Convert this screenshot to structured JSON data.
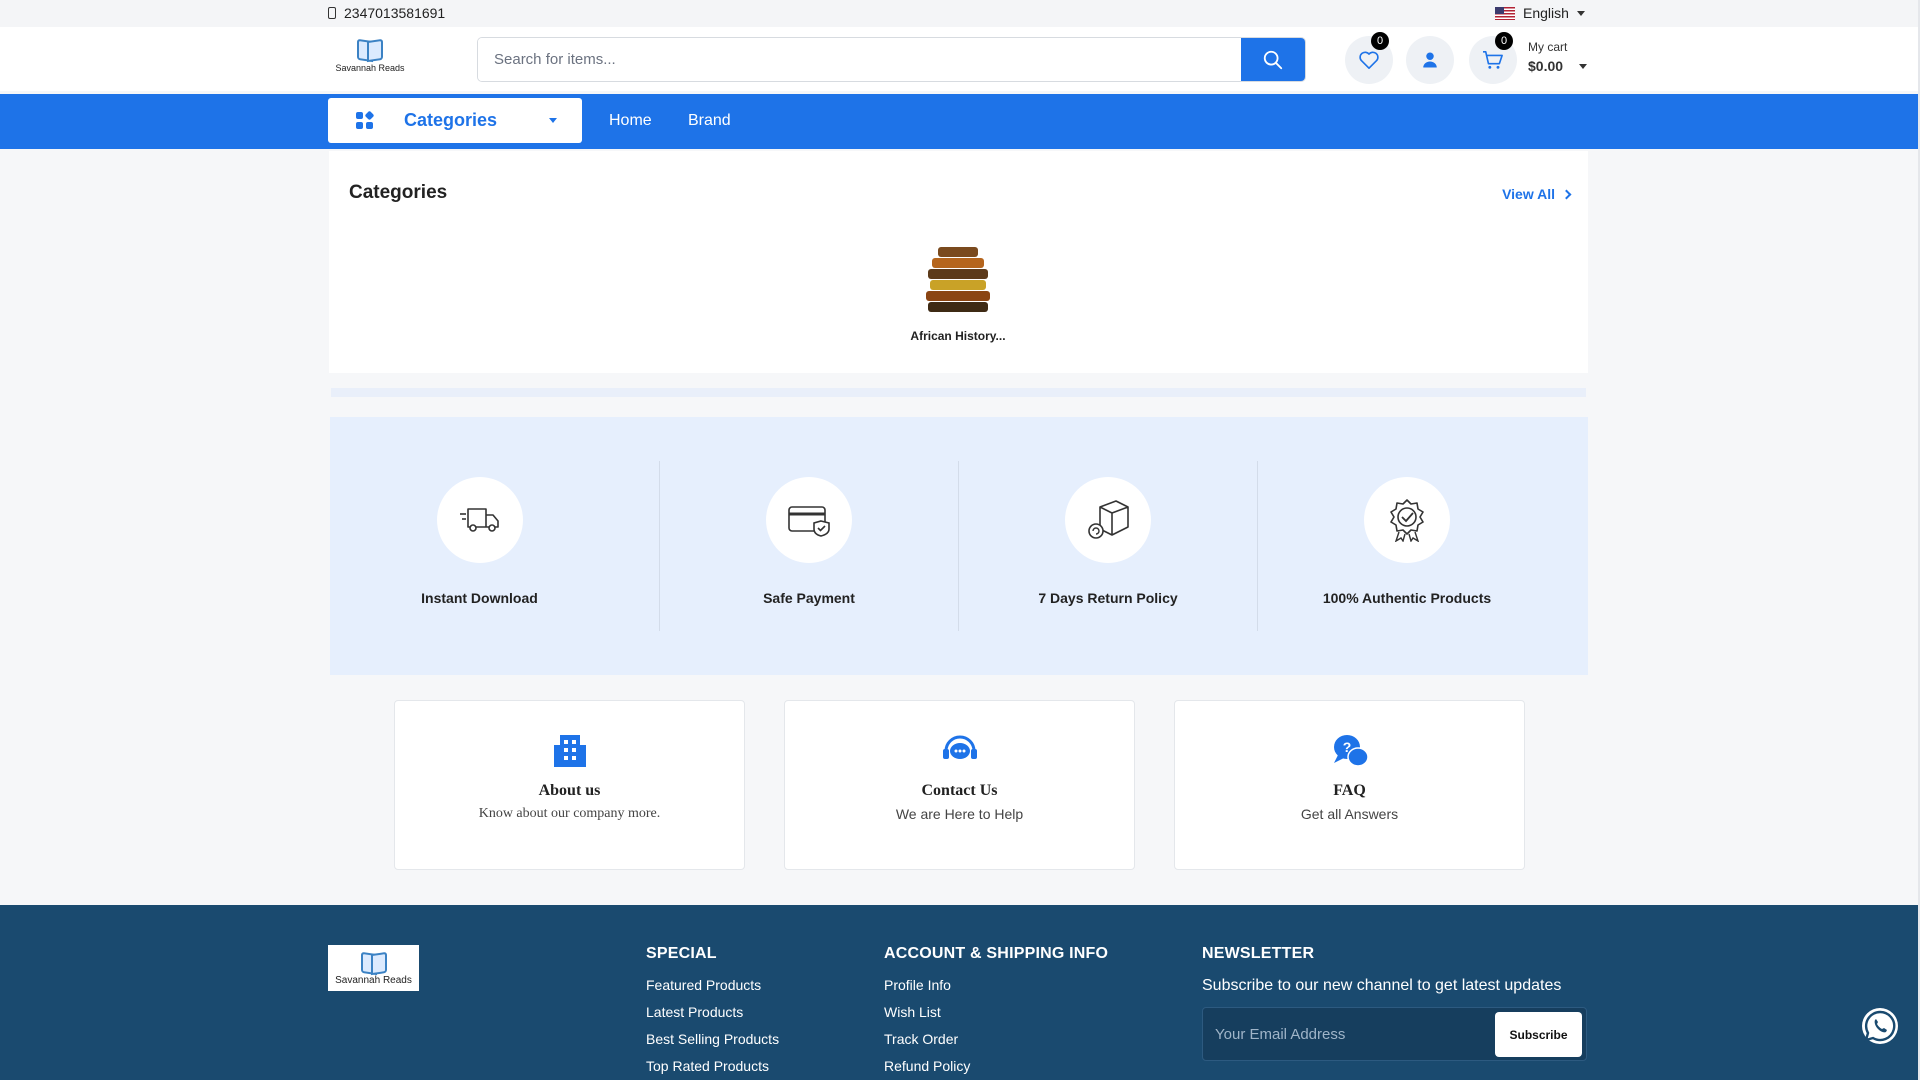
{
  "topbar": {
    "phone": "2347013581691",
    "language": "English"
  },
  "header": {
    "logo_text": "Savannah Reads",
    "search_placeholder": "Search for items...",
    "wishlist_count": "0",
    "cart_count": "0",
    "cart_label": "My cart",
    "cart_total": "$0.00"
  },
  "nav": {
    "categories_label": "Categories",
    "links": [
      "Home",
      "Brand"
    ]
  },
  "categories_section": {
    "title": "Categories",
    "view_all": "View All",
    "items": [
      {
        "name": "African History..."
      }
    ]
  },
  "features": [
    {
      "label": "Instant Download",
      "icon": "truck-icon"
    },
    {
      "label": "Safe Payment",
      "icon": "card-shield-icon"
    },
    {
      "label": "7 Days Return Policy",
      "icon": "box-return-icon"
    },
    {
      "label": "100% Authentic Products",
      "icon": "badge-check-icon"
    }
  ],
  "info_cards": [
    {
      "title": "About us",
      "subtitle": "Know about our company more.",
      "icon": "building-icon"
    },
    {
      "title": "Contact Us",
      "subtitle": "We are Here to Help",
      "icon": "headset-chat-icon"
    },
    {
      "title": "FAQ",
      "subtitle": "Get all Answers",
      "icon": "question-chat-icon"
    }
  ],
  "footer": {
    "logo_text": "Savannah Reads",
    "special": {
      "title": "SPECIAL",
      "links": [
        "Featured Products",
        "Latest Products",
        "Best Selling Products",
        "Top Rated Products"
      ]
    },
    "account": {
      "title": "ACCOUNT & SHIPPING INFO",
      "links": [
        "Profile Info",
        "Wish List",
        "Track Order",
        "Refund Policy"
      ]
    },
    "newsletter": {
      "title": "NEWSLETTER",
      "text": "Subscribe to our new channel to get latest updates",
      "placeholder": "Your Email Address",
      "button": "Subscribe"
    }
  },
  "colors": {
    "primary": "#1e73e8",
    "footer_bg": "#1a4a6f",
    "feature_bg": "#e6effd"
  }
}
